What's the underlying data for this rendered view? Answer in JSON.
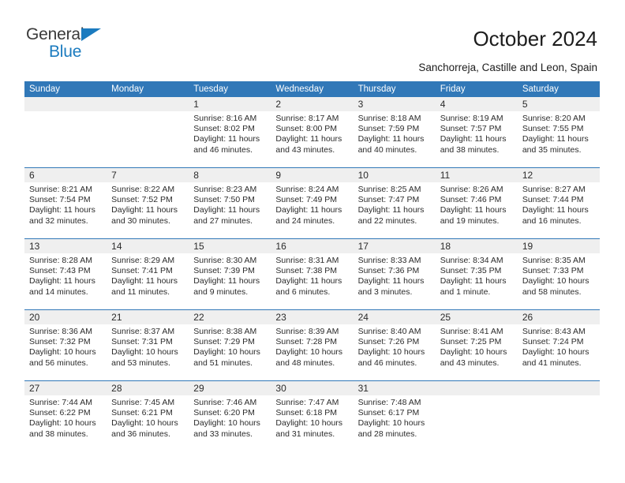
{
  "logo": {
    "word1": "General",
    "word2": "Blue",
    "triangle_color": "#1b7bbf",
    "text_color": "#3a3a3a"
  },
  "header": {
    "title": "October 2024",
    "subtitle": "Sanchorreja, Castille and Leon, Spain"
  },
  "theme": {
    "header_blue": "#3178b8",
    "daynum_band": "#efefef",
    "text": "#2b2b2b"
  },
  "weekdays": [
    "Sunday",
    "Monday",
    "Tuesday",
    "Wednesday",
    "Thursday",
    "Friday",
    "Saturday"
  ],
  "weeks": [
    {
      "days": [
        {
          "num": "",
          "lines": []
        },
        {
          "num": "",
          "lines": []
        },
        {
          "num": "1",
          "lines": [
            "Sunrise: 8:16 AM",
            "Sunset: 8:02 PM",
            "Daylight: 11 hours",
            "and 46 minutes."
          ]
        },
        {
          "num": "2",
          "lines": [
            "Sunrise: 8:17 AM",
            "Sunset: 8:00 PM",
            "Daylight: 11 hours",
            "and 43 minutes."
          ]
        },
        {
          "num": "3",
          "lines": [
            "Sunrise: 8:18 AM",
            "Sunset: 7:59 PM",
            "Daylight: 11 hours",
            "and 40 minutes."
          ]
        },
        {
          "num": "4",
          "lines": [
            "Sunrise: 8:19 AM",
            "Sunset: 7:57 PM",
            "Daylight: 11 hours",
            "and 38 minutes."
          ]
        },
        {
          "num": "5",
          "lines": [
            "Sunrise: 8:20 AM",
            "Sunset: 7:55 PM",
            "Daylight: 11 hours",
            "and 35 minutes."
          ]
        }
      ]
    },
    {
      "days": [
        {
          "num": "6",
          "lines": [
            "Sunrise: 8:21 AM",
            "Sunset: 7:54 PM",
            "Daylight: 11 hours",
            "and 32 minutes."
          ]
        },
        {
          "num": "7",
          "lines": [
            "Sunrise: 8:22 AM",
            "Sunset: 7:52 PM",
            "Daylight: 11 hours",
            "and 30 minutes."
          ]
        },
        {
          "num": "8",
          "lines": [
            "Sunrise: 8:23 AM",
            "Sunset: 7:50 PM",
            "Daylight: 11 hours",
            "and 27 minutes."
          ]
        },
        {
          "num": "9",
          "lines": [
            "Sunrise: 8:24 AM",
            "Sunset: 7:49 PM",
            "Daylight: 11 hours",
            "and 24 minutes."
          ]
        },
        {
          "num": "10",
          "lines": [
            "Sunrise: 8:25 AM",
            "Sunset: 7:47 PM",
            "Daylight: 11 hours",
            "and 22 minutes."
          ]
        },
        {
          "num": "11",
          "lines": [
            "Sunrise: 8:26 AM",
            "Sunset: 7:46 PM",
            "Daylight: 11 hours",
            "and 19 minutes."
          ]
        },
        {
          "num": "12",
          "lines": [
            "Sunrise: 8:27 AM",
            "Sunset: 7:44 PM",
            "Daylight: 11 hours",
            "and 16 minutes."
          ]
        }
      ]
    },
    {
      "days": [
        {
          "num": "13",
          "lines": [
            "Sunrise: 8:28 AM",
            "Sunset: 7:43 PM",
            "Daylight: 11 hours",
            "and 14 minutes."
          ]
        },
        {
          "num": "14",
          "lines": [
            "Sunrise: 8:29 AM",
            "Sunset: 7:41 PM",
            "Daylight: 11 hours",
            "and 11 minutes."
          ]
        },
        {
          "num": "15",
          "lines": [
            "Sunrise: 8:30 AM",
            "Sunset: 7:39 PM",
            "Daylight: 11 hours",
            "and 9 minutes."
          ]
        },
        {
          "num": "16",
          "lines": [
            "Sunrise: 8:31 AM",
            "Sunset: 7:38 PM",
            "Daylight: 11 hours",
            "and 6 minutes."
          ]
        },
        {
          "num": "17",
          "lines": [
            "Sunrise: 8:33 AM",
            "Sunset: 7:36 PM",
            "Daylight: 11 hours",
            "and 3 minutes."
          ]
        },
        {
          "num": "18",
          "lines": [
            "Sunrise: 8:34 AM",
            "Sunset: 7:35 PM",
            "Daylight: 11 hours",
            "and 1 minute."
          ]
        },
        {
          "num": "19",
          "lines": [
            "Sunrise: 8:35 AM",
            "Sunset: 7:33 PM",
            "Daylight: 10 hours",
            "and 58 minutes."
          ]
        }
      ]
    },
    {
      "days": [
        {
          "num": "20",
          "lines": [
            "Sunrise: 8:36 AM",
            "Sunset: 7:32 PM",
            "Daylight: 10 hours",
            "and 56 minutes."
          ]
        },
        {
          "num": "21",
          "lines": [
            "Sunrise: 8:37 AM",
            "Sunset: 7:31 PM",
            "Daylight: 10 hours",
            "and 53 minutes."
          ]
        },
        {
          "num": "22",
          "lines": [
            "Sunrise: 8:38 AM",
            "Sunset: 7:29 PM",
            "Daylight: 10 hours",
            "and 51 minutes."
          ]
        },
        {
          "num": "23",
          "lines": [
            "Sunrise: 8:39 AM",
            "Sunset: 7:28 PM",
            "Daylight: 10 hours",
            "and 48 minutes."
          ]
        },
        {
          "num": "24",
          "lines": [
            "Sunrise: 8:40 AM",
            "Sunset: 7:26 PM",
            "Daylight: 10 hours",
            "and 46 minutes."
          ]
        },
        {
          "num": "25",
          "lines": [
            "Sunrise: 8:41 AM",
            "Sunset: 7:25 PM",
            "Daylight: 10 hours",
            "and 43 minutes."
          ]
        },
        {
          "num": "26",
          "lines": [
            "Sunrise: 8:43 AM",
            "Sunset: 7:24 PM",
            "Daylight: 10 hours",
            "and 41 minutes."
          ]
        }
      ]
    },
    {
      "days": [
        {
          "num": "27",
          "lines": [
            "Sunrise: 7:44 AM",
            "Sunset: 6:22 PM",
            "Daylight: 10 hours",
            "and 38 minutes."
          ]
        },
        {
          "num": "28",
          "lines": [
            "Sunrise: 7:45 AM",
            "Sunset: 6:21 PM",
            "Daylight: 10 hours",
            "and 36 minutes."
          ]
        },
        {
          "num": "29",
          "lines": [
            "Sunrise: 7:46 AM",
            "Sunset: 6:20 PM",
            "Daylight: 10 hours",
            "and 33 minutes."
          ]
        },
        {
          "num": "30",
          "lines": [
            "Sunrise: 7:47 AM",
            "Sunset: 6:18 PM",
            "Daylight: 10 hours",
            "and 31 minutes."
          ]
        },
        {
          "num": "31",
          "lines": [
            "Sunrise: 7:48 AM",
            "Sunset: 6:17 PM",
            "Daylight: 10 hours",
            "and 28 minutes."
          ]
        },
        {
          "num": "",
          "lines": []
        },
        {
          "num": "",
          "lines": []
        }
      ]
    }
  ]
}
